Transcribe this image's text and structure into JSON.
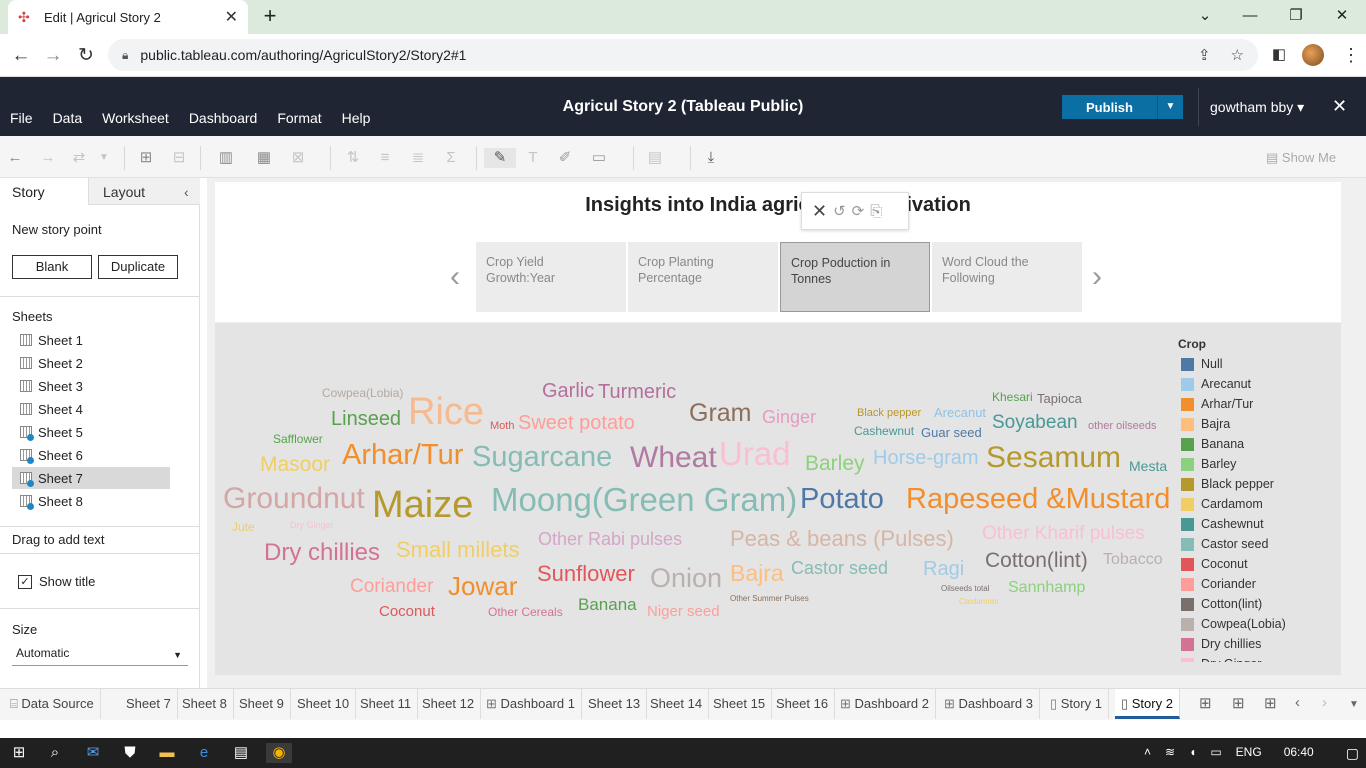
{
  "browser": {
    "tab_title": "Edit | Agricul Story 2",
    "url": "public.tableau.com/authoring/AgriculStory2/Story2#1"
  },
  "app": {
    "title": "Agricul Story 2 (Tableau Public)",
    "menus": [
      "File",
      "Data",
      "Worksheet",
      "Dashboard",
      "Format",
      "Help"
    ],
    "publish_label": "Publish",
    "user": "gowtham bby ▾",
    "show_me": "Show Me"
  },
  "left_pane": {
    "tabs": {
      "story": "Story",
      "layout": "Layout"
    },
    "new_story_point": "New story point",
    "blank": "Blank",
    "duplicate": "Duplicate",
    "sheets_header": "Sheets",
    "sheets": [
      "Sheet 1",
      "Sheet 2",
      "Sheet 3",
      "Sheet 4",
      "Sheet 5",
      "Sheet 6",
      "Sheet 7",
      "Sheet 8"
    ],
    "selected_sheet": "Sheet 7",
    "drag_text": "Drag to add text",
    "show_title": "Show title",
    "size_header": "Size",
    "size_value": "Automatic"
  },
  "story": {
    "title": "Insights into India agriculture cultivation",
    "points": [
      "Crop Yield Growth:Year",
      "Crop Planting Percentage",
      "Crop Poduction in Tonnes",
      "Word Cloud the Following"
    ],
    "active_point": 2
  },
  "word_cloud": [
    {
      "text": "Cowpea(Lobia)",
      "color": "#b3a9a2"
    },
    {
      "text": "Rice",
      "color": "#f7b98e"
    },
    {
      "text": "Garlic",
      "color": "#b46f9c"
    },
    {
      "text": "Turmeric",
      "color": "#b46f9c"
    },
    {
      "text": "Gram",
      "color": "#8b6f5a"
    },
    {
      "text": "Ginger",
      "color": "#e79bc3"
    },
    {
      "text": "Black pepper",
      "color": "#b9962b"
    },
    {
      "text": "Arecanut",
      "color": "#8fc4e6"
    },
    {
      "text": "Khesari",
      "color": "#55a34c"
    },
    {
      "text": "Tapioca",
      "color": "#79706e"
    },
    {
      "text": "Linseed",
      "color": "#59a14f"
    },
    {
      "text": "Moth",
      "color": "#e15759"
    },
    {
      "text": "Sweet potato",
      "color": "#ff9d9a"
    },
    {
      "text": "Cashewnut",
      "color": "#499894"
    },
    {
      "text": "Guar seed",
      "color": "#4e79a7"
    },
    {
      "text": "Soyabean",
      "color": "#499894"
    },
    {
      "text": "other oilseeds",
      "color": "#b07aa1"
    },
    {
      "text": "Safflower",
      "color": "#59a14f"
    },
    {
      "text": "Masoor",
      "color": "#f1ce63"
    },
    {
      "text": "Arhar/Tur",
      "color": "#f28e2b"
    },
    {
      "text": "Sugarcane",
      "color": "#86bcb6"
    },
    {
      "text": "Wheat",
      "color": "#b07aa1"
    },
    {
      "text": "Urad",
      "color": "#fabfd2"
    },
    {
      "text": "Barley",
      "color": "#8cd17d"
    },
    {
      "text": "Horse-gram",
      "color": "#a0cbe8"
    },
    {
      "text": "Sesamum",
      "color": "#b6992d"
    },
    {
      "text": "Mesta",
      "color": "#499894"
    },
    {
      "text": "Groundnut",
      "color": "#d4a6a6"
    },
    {
      "text": "Maize",
      "color": "#b6992d"
    },
    {
      "text": "Moong(Green Gram)",
      "color": "#86bcb6"
    },
    {
      "text": "Potato",
      "color": "#4e79a7"
    },
    {
      "text": "Rapeseed &Mustard",
      "color": "#f28e2b"
    },
    {
      "text": "Jute",
      "color": "#f1ce63"
    },
    {
      "text": "Dry Ginger",
      "color": "#fabfd2"
    },
    {
      "text": "Dry chillies",
      "color": "#d37295"
    },
    {
      "text": "Small millets",
      "color": "#f1ce63"
    },
    {
      "text": "Other Rabi pulses",
      "color": "#d4a6c8"
    },
    {
      "text": "Peas & beans (Pulses)",
      "color": "#d7b5a6"
    },
    {
      "text": "Other Kharif pulses",
      "color": "#fabfd2"
    },
    {
      "text": "Cotton(lint)",
      "color": "#79706e"
    },
    {
      "text": "Tobacco",
      "color": "#bab0ac"
    },
    {
      "text": "Coriander",
      "color": "#ff9d9a"
    },
    {
      "text": "Jowar",
      "color": "#f28e2b"
    },
    {
      "text": "Sunflower",
      "color": "#e15759"
    },
    {
      "text": "Onion",
      "color": "#bab0ac"
    },
    {
      "text": "Bajra",
      "color": "#ffbe7d"
    },
    {
      "text": "Castor seed",
      "color": "#86bcb6"
    },
    {
      "text": "Ragi",
      "color": "#a0cbe8"
    },
    {
      "text": "Oilseeds total",
      "color": "#79706e"
    },
    {
      "text": "Sannhamp",
      "color": "#8cd17d"
    },
    {
      "text": "Cardamom",
      "color": "#f1ce63"
    },
    {
      "text": "Coconut",
      "color": "#e15759"
    },
    {
      "text": "Other Cereals",
      "color": "#d37295"
    },
    {
      "text": "Banana",
      "color": "#59a14f"
    },
    {
      "text": "Niger seed",
      "color": "#ff9d9a"
    },
    {
      "text": "Other Summer Pulses",
      "color": "#8b6f5a"
    }
  ],
  "legend": {
    "title": "Crop",
    "items": [
      {
        "label": "Null",
        "color": "#4e79a7"
      },
      {
        "label": "Arecanut",
        "color": "#a0cbe8"
      },
      {
        "label": "Arhar/Tur",
        "color": "#f28e2b"
      },
      {
        "label": "Bajra",
        "color": "#ffbe7d"
      },
      {
        "label": "Banana",
        "color": "#59a14f"
      },
      {
        "label": "Barley",
        "color": "#8cd17d"
      },
      {
        "label": "Black pepper",
        "color": "#b6992d"
      },
      {
        "label": "Cardamom",
        "color": "#f1ce63"
      },
      {
        "label": "Cashewnut",
        "color": "#499894"
      },
      {
        "label": "Castor seed",
        "color": "#86bcb6"
      },
      {
        "label": "Coconut",
        "color": "#e15759"
      },
      {
        "label": "Coriander",
        "color": "#ff9d9a"
      },
      {
        "label": "Cotton(lint)",
        "color": "#79706e"
      },
      {
        "label": "Cowpea(Lobia)",
        "color": "#bab0ac"
      },
      {
        "label": "Dry chillies",
        "color": "#d37295"
      },
      {
        "label": "Dry Ginger",
        "color": "#fabfd2"
      }
    ]
  },
  "bottom_tabs": [
    "Data Source",
    "Sheet 7",
    "Sheet 8",
    "Sheet 9",
    "Sheet 10",
    "Sheet 11",
    "Sheet 12",
    "Dashboard 1",
    "Sheet 13",
    "Sheet 14",
    "Sheet 15",
    "Sheet 16",
    "Dashboard 2",
    "Dashboard 3",
    "Story 1",
    "Story 2"
  ],
  "selected_bottom_tab": "Story 2",
  "taskbar": {
    "lang": "ENG",
    "time": "06:40"
  }
}
